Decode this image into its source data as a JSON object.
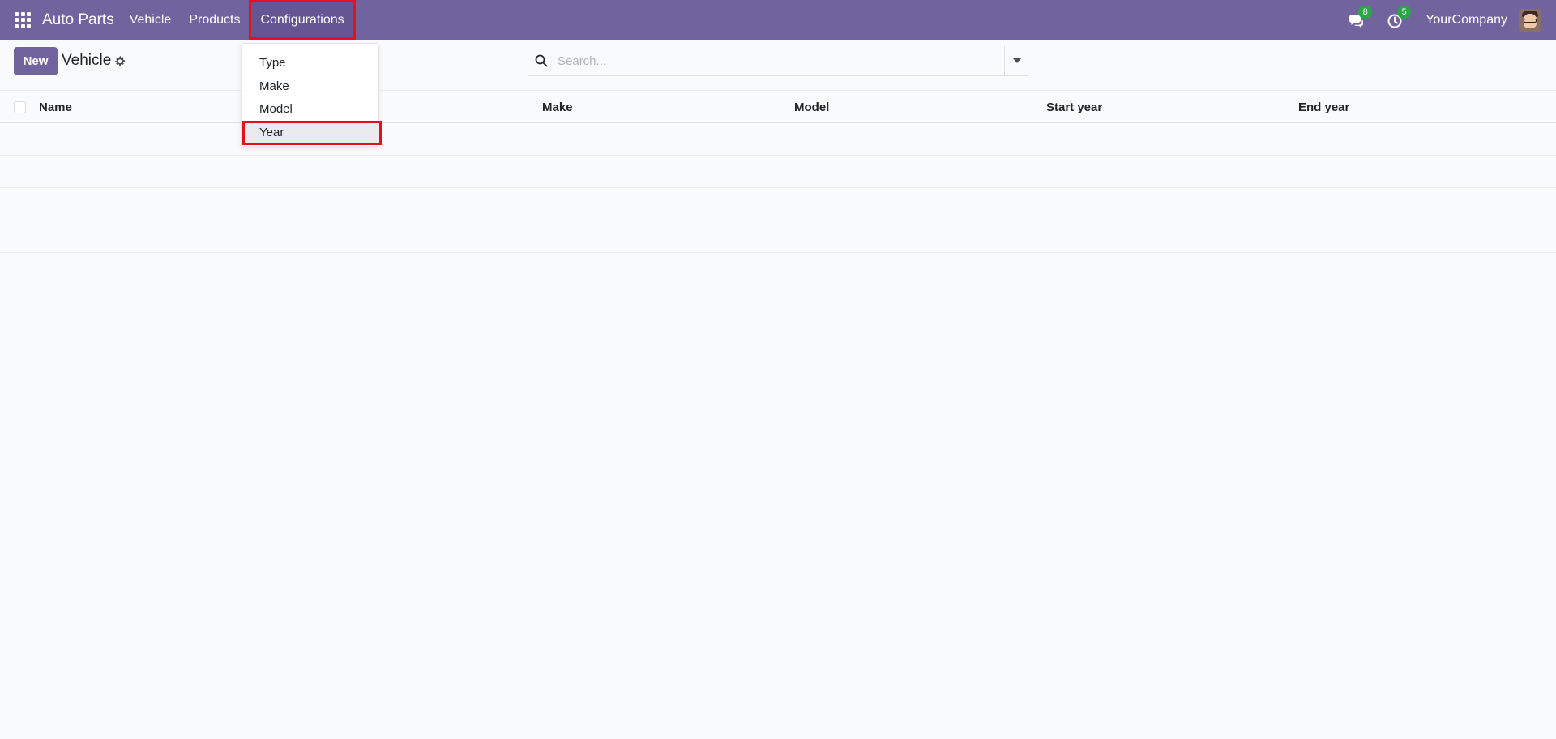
{
  "navbar": {
    "brand": "Auto Parts",
    "menu": [
      {
        "label": "Vehicle"
      },
      {
        "label": "Products"
      },
      {
        "label": "Configurations"
      }
    ],
    "messages_count": "8",
    "activities_count": "5",
    "company": "YourCompany",
    "colors": {
      "bar": "#71639e",
      "badge": "#28a745",
      "highlight": "#e3121a"
    }
  },
  "control_panel": {
    "new_label": "New",
    "title": "Vehicle"
  },
  "search": {
    "placeholder": "Search..."
  },
  "dropdown": {
    "items": [
      {
        "label": "Type"
      },
      {
        "label": "Make"
      },
      {
        "label": "Model"
      },
      {
        "label": "Year"
      }
    ]
  },
  "table": {
    "columns": [
      "Name",
      "Make",
      "Model",
      "Start year",
      "End year"
    ]
  },
  "icons": [
    "apps-grid-icon",
    "chat-icon",
    "clock-icon",
    "gear-icon",
    "search-icon",
    "caret-down-icon"
  ]
}
